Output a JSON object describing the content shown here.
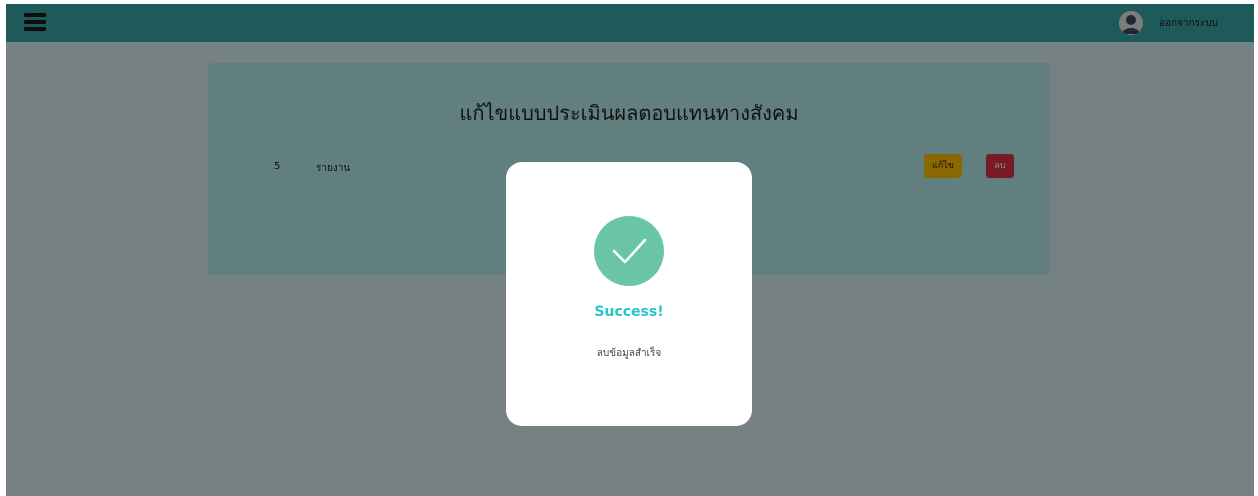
{
  "header": {
    "menu_icon": "hamburger-menu-icon",
    "avatar_icon": "user-avatar-icon",
    "logout_label": "ออกจากระบบ"
  },
  "card": {
    "title": "แก้ไขแบบประเมินผลตอบแทนทางสังคม",
    "rows": [
      {
        "number": "5",
        "label": "รายงาน",
        "edit_label": "แก้ไข",
        "delete_label": "ลบ"
      }
    ]
  },
  "modal": {
    "icon": "check-icon",
    "title": "Success!",
    "message": "ลบข้อมูลสำเร็จ"
  },
  "colors": {
    "topbar": "#3aa6a8",
    "card": "#b3eaeb",
    "edit_button": "#ffc107",
    "delete_button": "#dc3545",
    "success_icon": "#6ac4a8",
    "success_title": "#26c6c6"
  }
}
